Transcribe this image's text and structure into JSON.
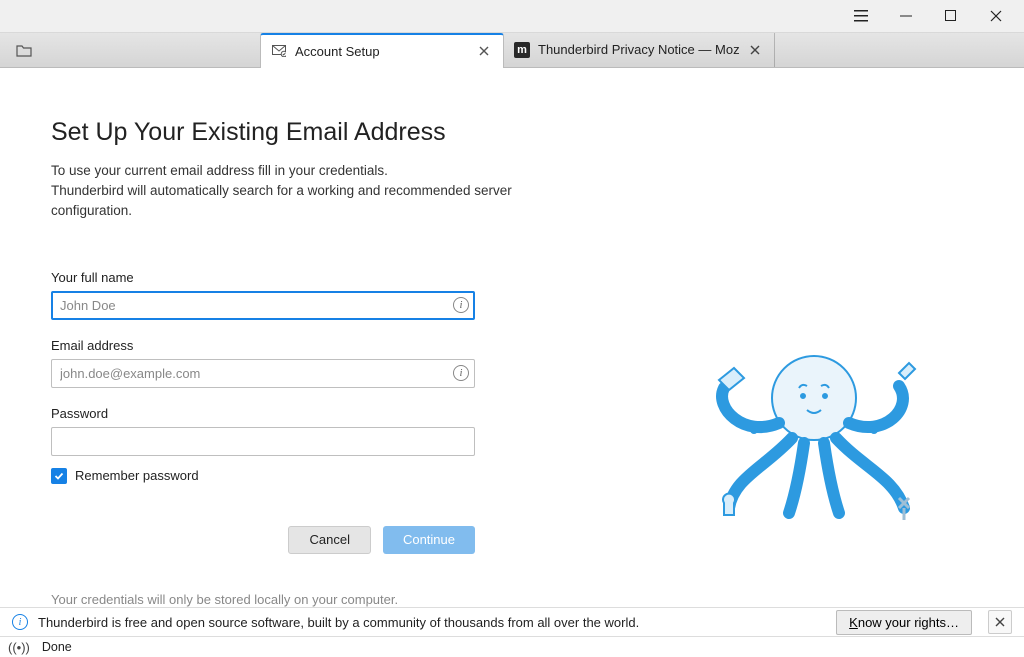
{
  "titlebar": {
    "menu_icon": "menu",
    "min_icon": "minimize",
    "max_icon": "maximize",
    "close_icon": "close"
  },
  "tabs": {
    "active": {
      "label": "Account Setup"
    },
    "inactive": {
      "label": "Thunderbird Privacy Notice — Moz"
    }
  },
  "setup": {
    "heading": "Set Up Your Existing Email Address",
    "sub1": "To use your current email address fill in your credentials.",
    "sub2": "Thunderbird will automatically search for a working and recommended server configuration.",
    "name_label": "Your full name",
    "name_placeholder": "John Doe",
    "email_label": "Email address",
    "email_placeholder": "john.doe@example.com",
    "password_label": "Password",
    "remember_label": "Remember password",
    "cancel_label": "Cancel",
    "continue_label": "Continue",
    "cred_note": "Your credentials will only be stored locally on your computer."
  },
  "notice": {
    "text": "Thunderbird is free and open source software, built by a community of thousands from all over the world.",
    "rights_prefix": "K",
    "rights_rest": "now your rights…"
  },
  "status": {
    "text": "Done"
  }
}
